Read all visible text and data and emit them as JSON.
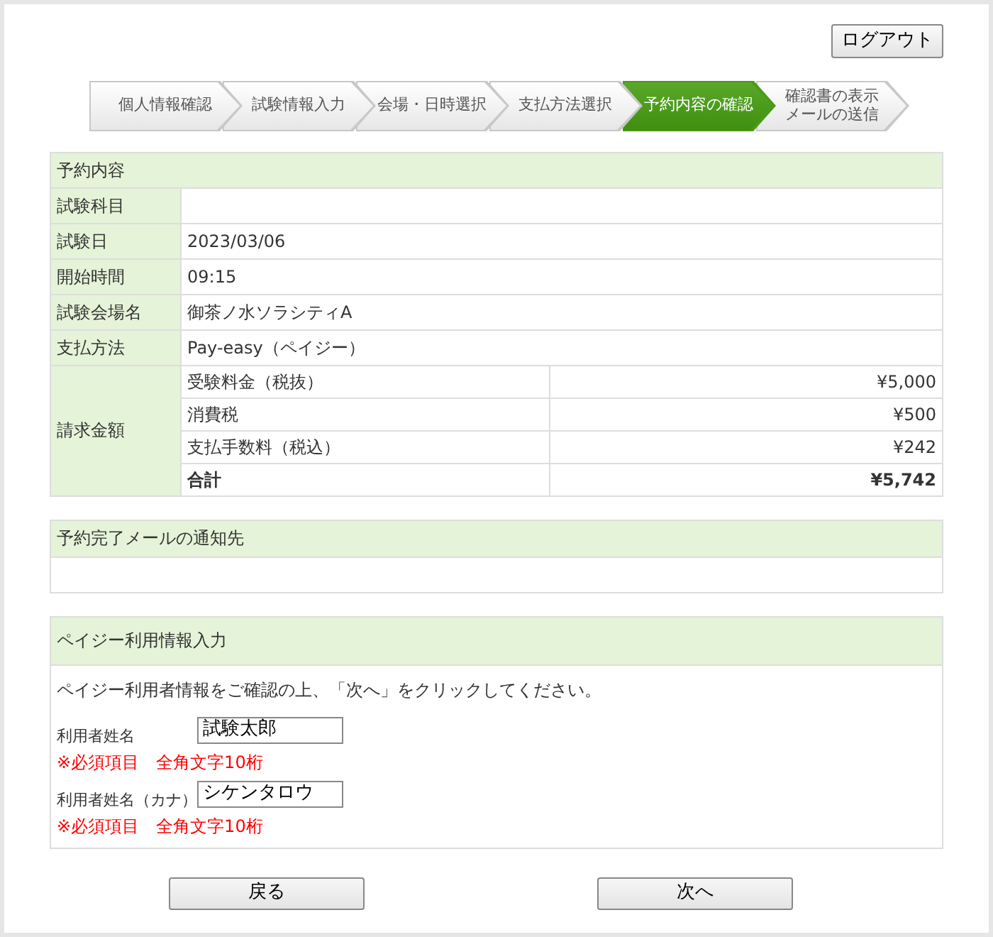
{
  "logout_button": "ログアウト",
  "steps": [
    {
      "lines": [
        "個人情報確認"
      ],
      "selected": false
    },
    {
      "lines": [
        "試験情報入力"
      ],
      "selected": false
    },
    {
      "lines": [
        "会場・日時選択"
      ],
      "selected": false
    },
    {
      "lines": [
        "支払方法選択"
      ],
      "selected": false
    },
    {
      "lines": [
        "予約内容の確認"
      ],
      "selected": true
    },
    {
      "lines": [
        "確認書の表示",
        "メールの送信"
      ],
      "selected": false
    }
  ],
  "reservation": {
    "title": "予約内容",
    "rows": [
      {
        "label": "試験科目"
      },
      {
        "label": "試験日",
        "value": "2023/03/06"
      },
      {
        "label": "開始時間",
        "value": "09:15"
      },
      {
        "label": "試験会場名",
        "value": "御茶ノ水ソラシティA"
      },
      {
        "label": "支払方法",
        "value": "Pay-easy（ペイジー）"
      }
    ],
    "billing": {
      "label": "請求金額",
      "items": [
        {
          "name": "受験料金（税抜）",
          "amount": "¥5,000",
          "total": false
        },
        {
          "name": "消費税",
          "amount": "¥500",
          "total": false
        },
        {
          "name": "支払手数料（税込）",
          "amount": "¥242",
          "total": false
        },
        {
          "name": "合計",
          "amount": "¥5,742",
          "total": true
        }
      ]
    }
  },
  "notification": {
    "title": "予約完了メールの通知先"
  },
  "payeasy": {
    "title": "ペイジー利用情報入力",
    "instruction": "ペイジー利用者情報をご確認の上、「次へ」をクリックしてください。",
    "fields": [
      {
        "label": "利用者姓名",
        "value": "試験太郎",
        "note": "※必須項目　全角文字10桁"
      },
      {
        "label": "利用者姓名（カナ）",
        "value": "シケンタロウ",
        "note": "※必須項目　全角文字10桁"
      }
    ]
  },
  "buttons": [
    {
      "label": "戻る"
    },
    {
      "label": "次へ"
    }
  ]
}
